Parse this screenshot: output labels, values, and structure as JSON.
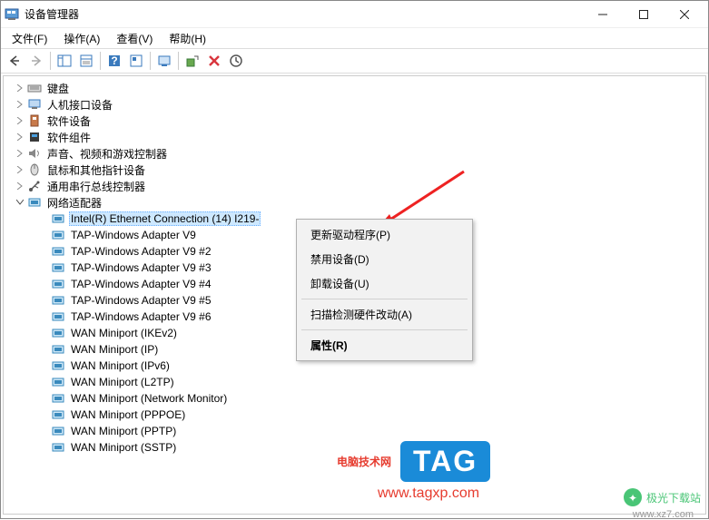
{
  "window": {
    "title": "设备管理器"
  },
  "menu": {
    "file": "文件(F)",
    "action": "操作(A)",
    "view": "查看(V)",
    "help": "帮助(H)"
  },
  "tree": {
    "keyboard": "键盘",
    "hid": "人机接口设备",
    "software_devices": "软件设备",
    "software_components": "软件组件",
    "sound": "声音、视频和游戏控制器",
    "mouse": "鼠标和其他指针设备",
    "usb": "通用串行总线控制器",
    "network": {
      "label": "网络适配器",
      "items": [
        "Intel(R) Ethernet Connection (14) I219-",
        "TAP-Windows Adapter V9",
        "TAP-Windows Adapter V9 #2",
        "TAP-Windows Adapter V9 #3",
        "TAP-Windows Adapter V9 #4",
        "TAP-Windows Adapter V9 #5",
        "TAP-Windows Adapter V9 #6",
        "WAN Miniport (IKEv2)",
        "WAN Miniport (IP)",
        "WAN Miniport (IPv6)",
        "WAN Miniport (L2TP)",
        "WAN Miniport (Network Monitor)",
        "WAN Miniport (PPPOE)",
        "WAN Miniport (PPTP)",
        "WAN Miniport (SSTP)"
      ]
    }
  },
  "context": {
    "update": "更新驱动程序(P)",
    "disable": "禁用设备(D)",
    "uninstall": "卸载设备(U)",
    "scan": "扫描检测硬件改动(A)",
    "properties": "属性(R)"
  },
  "watermarks": {
    "brand": "电脑技术网",
    "tag": "TAG",
    "url": "www.tagxp.com",
    "jxz": "极光下载站",
    "jxz_url": "www.xz7.com"
  }
}
